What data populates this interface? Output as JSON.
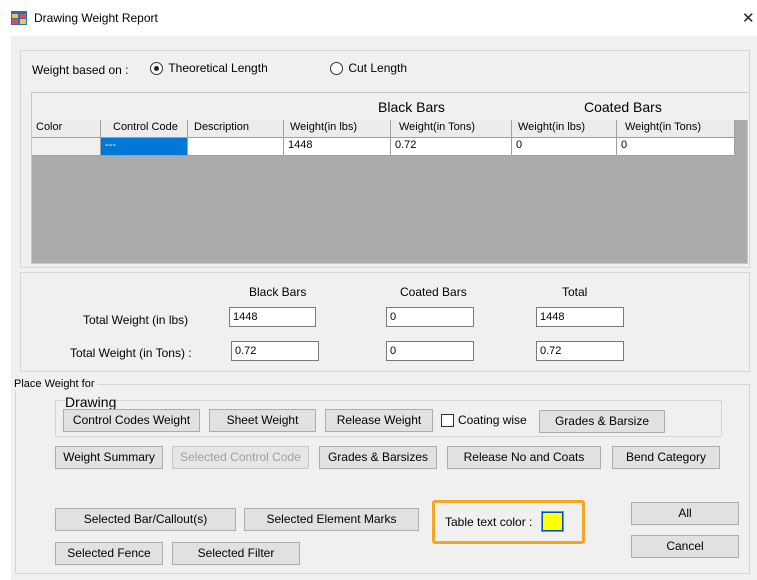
{
  "window": {
    "title": "Drawing Weight Report",
    "close_symbol": "✕"
  },
  "weight_basis": {
    "label": "Weight based on :",
    "options": [
      {
        "label": "Theoretical Length",
        "selected": true
      },
      {
        "label": "Cut Length",
        "selected": false
      }
    ]
  },
  "grid": {
    "group_headers": {
      "black": "Black Bars",
      "coated": "Coated Bars"
    },
    "columns": [
      "Color",
      "Control Code",
      "Description",
      "Weight(in lbs)",
      "Weight(in Tons)",
      "Weight(in lbs)",
      "Weight(in Tons)"
    ],
    "rows": [
      {
        "color": "",
        "control_code": "---",
        "description": "",
        "black_lbs": "1448",
        "black_tons": "0.72",
        "coated_lbs": "0",
        "coated_tons": "0"
      }
    ],
    "selection_color": "#0078d7",
    "empty_area_color": "#ababab"
  },
  "totals": {
    "headers": {
      "black": "Black Bars",
      "coated": "Coated Bars",
      "total": "Total"
    },
    "lbs_label": "Total Weight (in lbs)",
    "tons_label": "Total Weight (in Tons) :",
    "lbs": {
      "black": "1448",
      "coated": "0",
      "total": "1448"
    },
    "tons": {
      "black": "0.72",
      "coated": "0",
      "total": "0.72"
    }
  },
  "place_weight": {
    "label": "Place Weight for",
    "drawing": {
      "label": "Drawing",
      "buttons": {
        "control_codes": "Control Codes Weight",
        "sheet": "Sheet Weight",
        "release": "Release Weight",
        "coating_wise": "Coating wise",
        "grades_barsize": "Grades & Barsize"
      }
    },
    "row2": {
      "weight_summary": "Weight Summary",
      "selected_control_code": "Selected Control Code",
      "grades_barsizes": "Grades & Barsizes",
      "release_no_coats": "Release No and Coats",
      "bend_category": "Bend Category"
    },
    "selected_bar_callout": "Selected Bar/Callout(s)",
    "selected_element_marks": "Selected  Element Marks",
    "selected_fence": "Selected Fence",
    "selected_filter": "Selected Filter",
    "table_text_color": {
      "label": "Table text color :",
      "swatch": "#ffff00",
      "highlight": "#f5a623"
    },
    "all": "All",
    "cancel": "Cancel"
  }
}
